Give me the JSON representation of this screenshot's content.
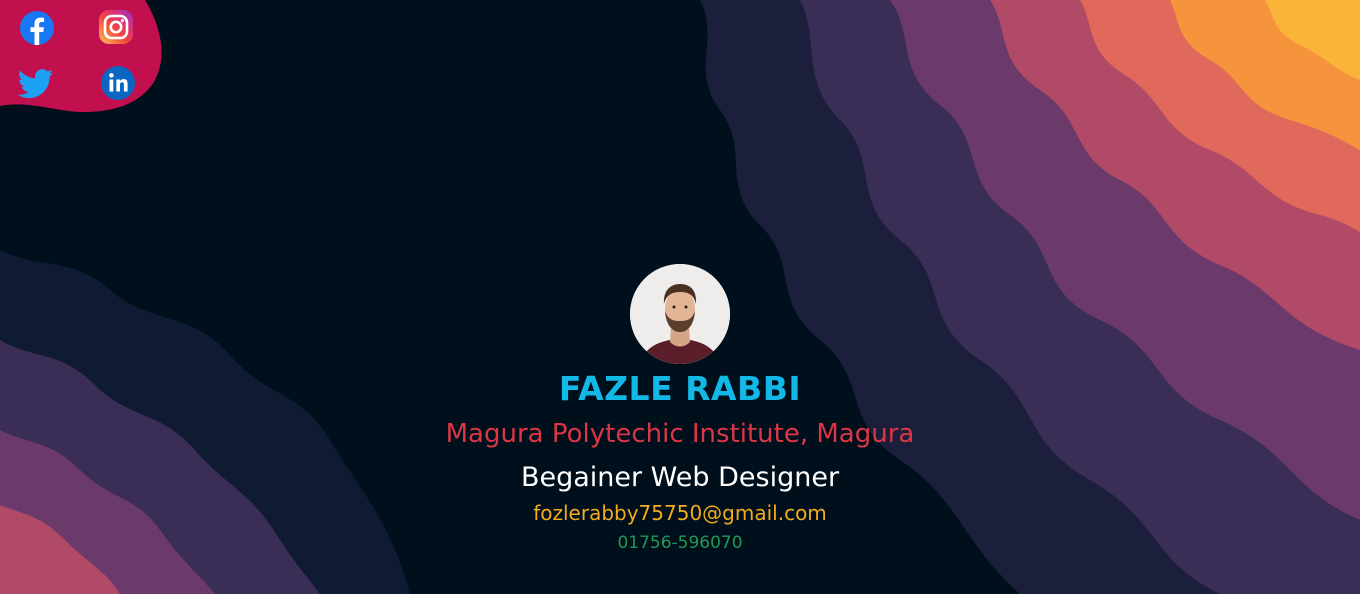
{
  "social": {
    "facebook": "facebook-icon",
    "instagram": "instagram-icon",
    "twitter": "twitter-icon",
    "linkedin": "linkedin-icon",
    "blob_color": "#c2104f"
  },
  "profile": {
    "name": "FAZLE RABBI",
    "institute": "Magura Polytechic Institute, Magura",
    "role": "Begainer Web Designer",
    "email": "fozlerabby75750@gmail.com",
    "phone": "01756-596070"
  },
  "colors": {
    "background": "#000f1c",
    "name": "#12b8e6",
    "institute": "#dc3545",
    "role": "#ffffff",
    "email": "#f2ac1c",
    "phone": "#1e9a56"
  }
}
